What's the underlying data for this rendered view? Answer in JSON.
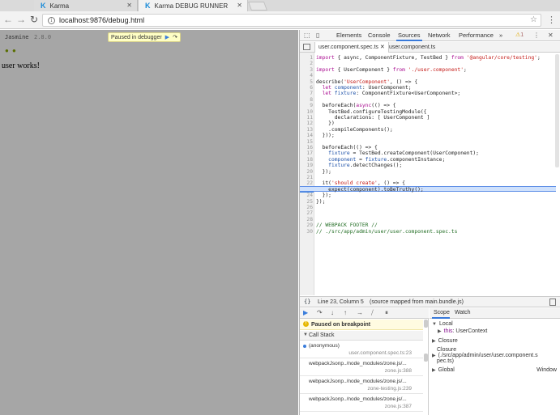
{
  "browser": {
    "tabs": [
      {
        "label": "Karma",
        "favicon": "karma-icon"
      },
      {
        "label": "Karma DEBUG RUNNER",
        "favicon": "karma-icon"
      }
    ],
    "url": "localhost:9876/debug.html"
  },
  "page": {
    "jasmine_title": "Jasmine",
    "jasmine_version": "2.8.0",
    "paused_label": "Paused in debugger",
    "dots": "● ●",
    "app_text": "user works!"
  },
  "devtools": {
    "panels": [
      "Elements",
      "Console",
      "Sources",
      "Network",
      "Performance"
    ],
    "active_panel": "Sources",
    "more": "»",
    "warn_count": "1",
    "file_tabs": [
      "user.component.spec.ts",
      "user.component.ts"
    ],
    "code_lines": [
      {
        "n": "1",
        "html": "<span class='kw'>import</span> { async, ComponentFixture, TestBed } <span class='kw'>from</span> <span class='str'>'@angular/core/testing'</span>;"
      },
      {
        "n": "2",
        "html": ""
      },
      {
        "n": "3",
        "html": "<span class='kw'>import</span> { UserComponent } <span class='kw'>from</span> <span class='str'>'./user.component'</span>;"
      },
      {
        "n": "4",
        "html": ""
      },
      {
        "n": "5",
        "html": "describe(<span class='str'>'UserComponent'</span>, () => {"
      },
      {
        "n": "6",
        "html": "  <span class='kw'>let</span> <span class='prop'>component</span>: UserComponent;"
      },
      {
        "n": "7",
        "html": "  <span class='kw'>let</span> <span class='prop'>fixture</span>: ComponentFixture&lt;UserComponent&gt;;"
      },
      {
        "n": "8",
        "html": ""
      },
      {
        "n": "9",
        "html": "  beforeEach(<span class='kw'>async</span>(() => {"
      },
      {
        "n": "10",
        "html": "    TestBed.configureTestingModule({"
      },
      {
        "n": "11",
        "html": "      declarations: [ UserComponent ]"
      },
      {
        "n": "12",
        "html": "    })"
      },
      {
        "n": "13",
        "html": "    .compileComponents();"
      },
      {
        "n": "14",
        "html": "  }));"
      },
      {
        "n": "15",
        "html": ""
      },
      {
        "n": "16",
        "html": "  beforeEach(() => {"
      },
      {
        "n": "17",
        "html": "    <span class='prop'>fixture</span> = TestBed.createComponent(UserComponent);"
      },
      {
        "n": "18",
        "html": "    <span class='prop'>component</span> = <span class='prop'>fixture</span>.componentInstance;"
      },
      {
        "n": "19",
        "html": "    <span class='prop'>fixture</span>.detectChanges();"
      },
      {
        "n": "20",
        "html": "  });"
      },
      {
        "n": "21",
        "html": ""
      },
      {
        "n": "22",
        "html": "  it(<span class='str'>'should create'</span>, () => {"
      },
      {
        "n": "23",
        "html": "    expect(component).toBeTruthy();"
      },
      {
        "n": "24",
        "html": "  });"
      },
      {
        "n": "25",
        "html": "});"
      },
      {
        "n": "26",
        "html": ""
      },
      {
        "n": "27",
        "html": ""
      },
      {
        "n": "28",
        "html": ""
      },
      {
        "n": "29",
        "html": "<span class='cmt'>// WEBPACK FOOTER //</span>"
      },
      {
        "n": "30",
        "html": "<span class='cmt'>// ./src/app/admin/user/user.component.spec.ts</span>"
      }
    ],
    "highlight_line": "23",
    "status": {
      "braces": "{}",
      "position": "Line 23, Column 5",
      "source_map": "(source mapped from main.bundle.js)"
    },
    "debugger": {
      "paused_text": "Paused on breakpoint",
      "call_stack_label": "Call Stack",
      "frames": [
        {
          "name": "(anonymous)",
          "loc": "user.component.spec.ts:23",
          "current": true
        },
        {
          "name": "webpackJsonp../node_modules/zone.js/...",
          "loc": "zone.js:388",
          "current": false
        },
        {
          "name": "webpackJsonp../node_modules/zone.js/...",
          "loc": "zone-testing.js:239",
          "current": false
        },
        {
          "name": "webpackJsonp../node_modules/zone.js/...",
          "loc": "zone.js:387",
          "current": false
        }
      ]
    },
    "scope": {
      "tabs": [
        "Scope",
        "Watch"
      ],
      "local_label": "Local",
      "this_key": "this",
      "this_value": "UserContext",
      "closure1": "Closure",
      "closure2": "Closure",
      "closure2_path_1": "(./src/app/admin/user/user.component.s",
      "closure2_path_2": "pec.ts)",
      "global_label": "Global",
      "global_value": "Window"
    }
  }
}
